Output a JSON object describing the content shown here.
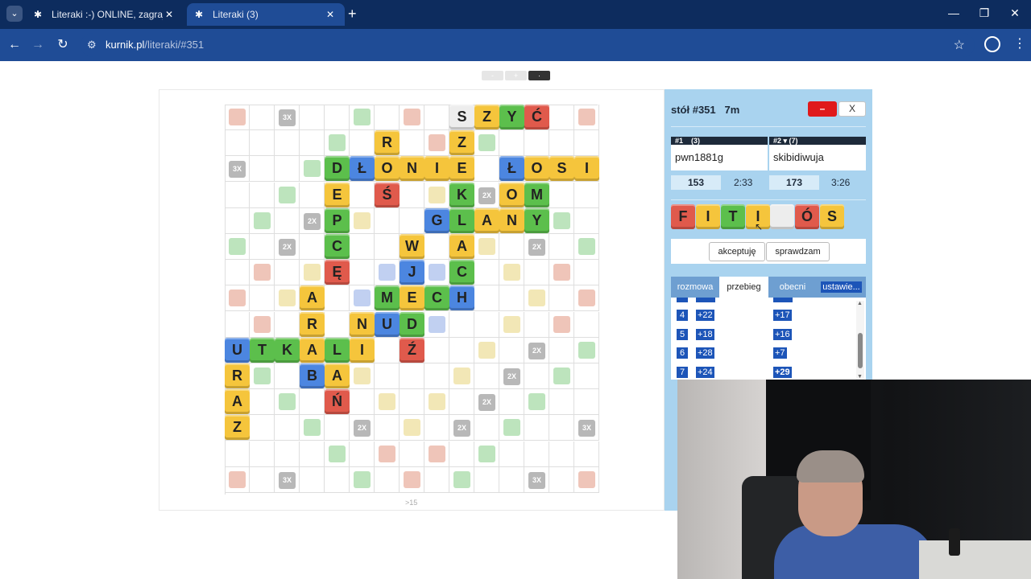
{
  "browser": {
    "tabs": [
      {
        "title": "Literaki :-) ONLINE, zagraj - Kur",
        "active": false
      },
      {
        "title": "Literaki (3)",
        "active": true
      }
    ],
    "url_domain": "kurnik.pl",
    "url_path": "/literaki/#351",
    "icons": [
      "tab-menu-icon",
      "favicon-icon",
      "close-icon",
      "new-tab-icon",
      "back-icon",
      "forward-icon",
      "reload-icon",
      "site-info-icon",
      "bookmark-star-icon",
      "profile-icon",
      "kebab-menu-icon",
      "minimize-icon",
      "restore-icon"
    ]
  },
  "page": {
    "zoom_minus": "-",
    "zoom_plus": "+",
    "zoom_dot": "·",
    "footnote": ">15"
  },
  "board": {
    "multipliers": [
      {
        "r": 0,
        "c": 2,
        "t": "3X"
      },
      {
        "r": 2,
        "c": 0,
        "t": "3X"
      },
      {
        "r": 3,
        "c": 10,
        "t": "2X"
      },
      {
        "r": 4,
        "c": 3,
        "t": "2X"
      },
      {
        "r": 5,
        "c": 2,
        "t": "2X"
      },
      {
        "r": 5,
        "c": 12,
        "t": "2X"
      },
      {
        "r": 9,
        "c": 12,
        "t": "2X"
      },
      {
        "r": 10,
        "c": 11,
        "t": "2X"
      },
      {
        "r": 11,
        "c": 10,
        "t": "2X"
      },
      {
        "r": 12,
        "c": 5,
        "t": "2X"
      },
      {
        "r": 12,
        "c": 9,
        "t": "2X"
      },
      {
        "r": 12,
        "c": 14,
        "t": "3X"
      },
      {
        "r": 14,
        "c": 2,
        "t": "3X"
      },
      {
        "r": 14,
        "c": 12,
        "t": "3X"
      }
    ],
    "tiles": [
      {
        "r": 0,
        "c": 9,
        "l": "S",
        "col": "w"
      },
      {
        "r": 0,
        "c": 10,
        "l": "Z",
        "col": "y"
      },
      {
        "r": 0,
        "c": 11,
        "l": "Y",
        "col": "g"
      },
      {
        "r": 0,
        "c": 12,
        "l": "Ć",
        "col": "r"
      },
      {
        "r": 1,
        "c": 6,
        "l": "R",
        "col": "y"
      },
      {
        "r": 1,
        "c": 9,
        "l": "Z",
        "col": "y"
      },
      {
        "r": 2,
        "c": 4,
        "l": "D",
        "col": "g"
      },
      {
        "r": 2,
        "c": 5,
        "l": "Ł",
        "col": "b"
      },
      {
        "r": 2,
        "c": 6,
        "l": "O",
        "col": "y"
      },
      {
        "r": 2,
        "c": 7,
        "l": "N",
        "col": "y"
      },
      {
        "r": 2,
        "c": 8,
        "l": "I",
        "col": "y"
      },
      {
        "r": 2,
        "c": 9,
        "l": "E",
        "col": "y"
      },
      {
        "r": 2,
        "c": 11,
        "l": "Ł",
        "col": "b"
      },
      {
        "r": 2,
        "c": 12,
        "l": "O",
        "col": "y"
      },
      {
        "r": 2,
        "c": 13,
        "l": "S",
        "col": "y"
      },
      {
        "r": 2,
        "c": 14,
        "l": "I",
        "col": "y"
      },
      {
        "r": 3,
        "c": 4,
        "l": "E",
        "col": "y"
      },
      {
        "r": 3,
        "c": 6,
        "l": "Ś",
        "col": "r"
      },
      {
        "r": 3,
        "c": 9,
        "l": "K",
        "col": "g"
      },
      {
        "r": 3,
        "c": 11,
        "l": "O",
        "col": "y"
      },
      {
        "r": 3,
        "c": 12,
        "l": "M",
        "col": "g"
      },
      {
        "r": 4,
        "c": 4,
        "l": "P",
        "col": "g"
      },
      {
        "r": 4,
        "c": 8,
        "l": "G",
        "col": "b"
      },
      {
        "r": 4,
        "c": 9,
        "l": "L",
        "col": "g"
      },
      {
        "r": 4,
        "c": 10,
        "l": "A",
        "col": "y"
      },
      {
        "r": 4,
        "c": 11,
        "l": "N",
        "col": "y"
      },
      {
        "r": 4,
        "c": 12,
        "l": "Y",
        "col": "g"
      },
      {
        "r": 5,
        "c": 4,
        "l": "C",
        "col": "g"
      },
      {
        "r": 5,
        "c": 7,
        "l": "W",
        "col": "y"
      },
      {
        "r": 5,
        "c": 9,
        "l": "A",
        "col": "y"
      },
      {
        "r": 6,
        "c": 4,
        "l": "Ę",
        "col": "r"
      },
      {
        "r": 6,
        "c": 7,
        "l": "J",
        "col": "b"
      },
      {
        "r": 6,
        "c": 9,
        "l": "C",
        "col": "g"
      },
      {
        "r": 7,
        "c": 3,
        "l": "A",
        "col": "y"
      },
      {
        "r": 7,
        "c": 6,
        "l": "M",
        "col": "g"
      },
      {
        "r": 7,
        "c": 7,
        "l": "E",
        "col": "y"
      },
      {
        "r": 7,
        "c": 8,
        "l": "C",
        "col": "g"
      },
      {
        "r": 7,
        "c": 9,
        "l": "H",
        "col": "b"
      },
      {
        "r": 8,
        "c": 3,
        "l": "R",
        "col": "y"
      },
      {
        "r": 8,
        "c": 5,
        "l": "N",
        "col": "y"
      },
      {
        "r": 8,
        "c": 6,
        "l": "U",
        "col": "b"
      },
      {
        "r": 8,
        "c": 7,
        "l": "D",
        "col": "g"
      },
      {
        "r": 9,
        "c": 0,
        "l": "U",
        "col": "b"
      },
      {
        "r": 9,
        "c": 1,
        "l": "T",
        "col": "g"
      },
      {
        "r": 9,
        "c": 2,
        "l": "K",
        "col": "g"
      },
      {
        "r": 9,
        "c": 3,
        "l": "A",
        "col": "y"
      },
      {
        "r": 9,
        "c": 4,
        "l": "L",
        "col": "g"
      },
      {
        "r": 9,
        "c": 5,
        "l": "I",
        "col": "y"
      },
      {
        "r": 9,
        "c": 7,
        "l": "Ź",
        "col": "r"
      },
      {
        "r": 10,
        "c": 0,
        "l": "R",
        "col": "y"
      },
      {
        "r": 10,
        "c": 3,
        "l": "B",
        "col": "b"
      },
      {
        "r": 10,
        "c": 4,
        "l": "A",
        "col": "y"
      },
      {
        "r": 11,
        "c": 0,
        "l": "A",
        "col": "y"
      },
      {
        "r": 11,
        "c": 4,
        "l": "Ń",
        "col": "r"
      },
      {
        "r": 12,
        "c": 0,
        "l": "Z",
        "col": "y"
      }
    ],
    "bonus_squares": [
      {
        "r": 0,
        "c": 0,
        "k": "word3"
      },
      {
        "r": 0,
        "c": 5,
        "k": "let2"
      },
      {
        "r": 0,
        "c": 7,
        "k": "word3"
      },
      {
        "r": 0,
        "c": 14,
        "k": "word3"
      },
      {
        "r": 1,
        "c": 4,
        "k": "let2"
      },
      {
        "r": 1,
        "c": 8,
        "k": "word3"
      },
      {
        "r": 1,
        "c": 10,
        "k": "let2"
      },
      {
        "r": 2,
        "c": 3,
        "k": "let2"
      },
      {
        "r": 3,
        "c": 2,
        "k": "let2"
      },
      {
        "r": 3,
        "c": 8,
        "k": "word2"
      },
      {
        "r": 4,
        "c": 1,
        "k": "let2"
      },
      {
        "r": 4,
        "c": 5,
        "k": "word2"
      },
      {
        "r": 4,
        "c": 13,
        "k": "let2"
      },
      {
        "r": 5,
        "c": 0,
        "k": "let2"
      },
      {
        "r": 5,
        "c": 10,
        "k": "word2"
      },
      {
        "r": 5,
        "c": 14,
        "k": "let2"
      },
      {
        "r": 6,
        "c": 1,
        "k": "word3"
      },
      {
        "r": 6,
        "c": 3,
        "k": "word2"
      },
      {
        "r": 6,
        "c": 6,
        "k": "let3"
      },
      {
        "r": 6,
        "c": 8,
        "k": "let3"
      },
      {
        "r": 6,
        "c": 11,
        "k": "word2"
      },
      {
        "r": 6,
        "c": 13,
        "k": "word3"
      },
      {
        "r": 7,
        "c": 0,
        "k": "word3"
      },
      {
        "r": 7,
        "c": 2,
        "k": "word2"
      },
      {
        "r": 7,
        "c": 5,
        "k": "let3"
      },
      {
        "r": 7,
        "c": 12,
        "k": "word2"
      },
      {
        "r": 7,
        "c": 14,
        "k": "word3"
      },
      {
        "r": 8,
        "c": 1,
        "k": "word3"
      },
      {
        "r": 8,
        "c": 8,
        "k": "let3"
      },
      {
        "r": 8,
        "c": 11,
        "k": "word2"
      },
      {
        "r": 8,
        "c": 13,
        "k": "word3"
      },
      {
        "r": 9,
        "c": 10,
        "k": "word2"
      },
      {
        "r": 9,
        "c": 14,
        "k": "let2"
      },
      {
        "r": 10,
        "c": 1,
        "k": "let2"
      },
      {
        "r": 10,
        "c": 5,
        "k": "word2"
      },
      {
        "r": 10,
        "c": 9,
        "k": "word2"
      },
      {
        "r": 10,
        "c": 13,
        "k": "let2"
      },
      {
        "r": 11,
        "c": 2,
        "k": "let2"
      },
      {
        "r": 11,
        "c": 6,
        "k": "word2"
      },
      {
        "r": 11,
        "c": 8,
        "k": "word2"
      },
      {
        "r": 11,
        "c": 12,
        "k": "let2"
      },
      {
        "r": 12,
        "c": 3,
        "k": "let2"
      },
      {
        "r": 12,
        "c": 7,
        "k": "word2"
      },
      {
        "r": 12,
        "c": 11,
        "k": "let2"
      },
      {
        "r": 13,
        "c": 4,
        "k": "let2"
      },
      {
        "r": 13,
        "c": 6,
        "k": "word3"
      },
      {
        "r": 13,
        "c": 8,
        "k": "word3"
      },
      {
        "r": 13,
        "c": 10,
        "k": "let2"
      },
      {
        "r": 14,
        "c": 0,
        "k": "word3"
      },
      {
        "r": 14,
        "c": 5,
        "k": "let2"
      },
      {
        "r": 14,
        "c": 7,
        "k": "word3"
      },
      {
        "r": 14,
        "c": 9,
        "k": "let2"
      },
      {
        "r": 14,
        "c": 14,
        "k": "word3"
      }
    ]
  },
  "side": {
    "title": "stół #351   7m",
    "minus_label": "–",
    "close_label": "X",
    "player1": {
      "head": "#1    (3)",
      "name": "pwn1881g",
      "score": "153",
      "time": "2:33"
    },
    "player2": {
      "head": "#2 ▾ (7)",
      "name": "skibidiwuja",
      "score": "173",
      "time": "3:26"
    },
    "rack": [
      {
        "l": "F",
        "col": "r"
      },
      {
        "l": "I",
        "col": "y"
      },
      {
        "l": "T",
        "col": "g"
      },
      {
        "l": "I",
        "col": "y"
      },
      {
        "l": "",
        "col": "w"
      },
      {
        "l": "Ó",
        "col": "r"
      },
      {
        "l": "S",
        "col": "y"
      }
    ],
    "accept_label": "akceptuję",
    "check_label": "sprawdzam",
    "tabs": [
      "rozmowa",
      "przebieg",
      "obecni",
      "ustawie..."
    ],
    "history": [
      {
        "n": "4",
        "p1": "+22",
        "p2": "+17"
      },
      {
        "n": "5",
        "p1": "+18",
        "p2": "+16"
      },
      {
        "n": "6",
        "p1": "+28",
        "p2": "+7"
      },
      {
        "n": "7",
        "p1": "+24",
        "p2": "+29"
      }
    ]
  },
  "colors": {
    "tile_yellow": "#f5c53c",
    "tile_green": "#5cbf4c",
    "tile_red": "#e05a4c",
    "tile_blue": "#4c86e0",
    "side_bg": "#a9d3ef",
    "browser_dark": "#0d2c5e"
  }
}
